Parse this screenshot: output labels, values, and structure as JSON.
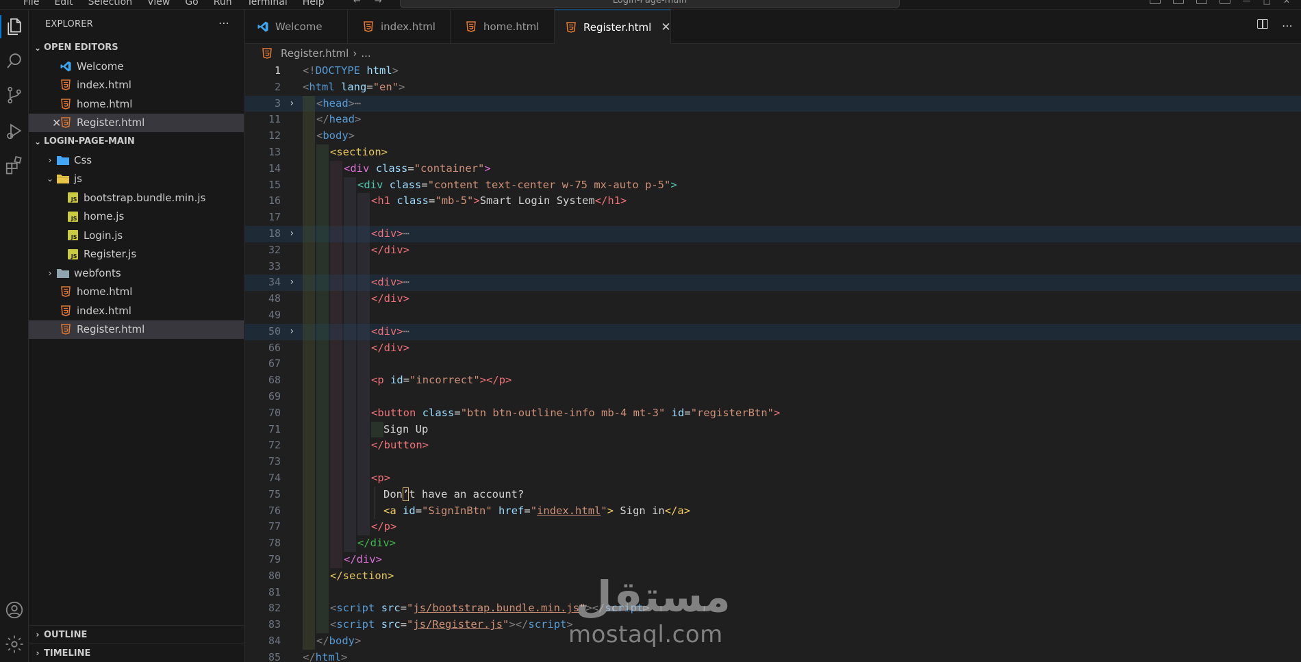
{
  "menu": [
    "File",
    "Edit",
    "Selection",
    "View",
    "Go",
    "Run",
    "Terminal",
    "Help"
  ],
  "command_center": "Login-Page-main",
  "sidebar": {
    "title": "EXPLORER",
    "open_editors_title": "OPEN EDITORS",
    "open_editors": [
      {
        "label": "Welcome",
        "icon": "vscode-icon"
      },
      {
        "label": "index.html",
        "icon": "html-file-icon"
      },
      {
        "label": "home.html",
        "icon": "html-file-icon"
      },
      {
        "label": "Register.html",
        "icon": "html-file-icon",
        "selected": true
      }
    ],
    "project_title": "LOGIN-PAGE-MAIN",
    "tree": [
      {
        "label": "Css",
        "type": "folder",
        "expanded": false
      },
      {
        "label": "js",
        "type": "folder",
        "expanded": true
      },
      {
        "label": "bootstrap.bundle.min.js",
        "type": "js"
      },
      {
        "label": "home.js",
        "type": "js"
      },
      {
        "label": "Login.js",
        "type": "js"
      },
      {
        "label": "Register.js",
        "type": "js"
      },
      {
        "label": "webfonts",
        "type": "folder",
        "expanded": false
      },
      {
        "label": "home.html",
        "type": "html"
      },
      {
        "label": "index.html",
        "type": "html"
      },
      {
        "label": "Register.html",
        "type": "html",
        "selected": true
      }
    ],
    "outline_title": "OUTLINE",
    "timeline_title": "TIMELINE"
  },
  "tabs": [
    {
      "label": "Welcome",
      "icon": "vscode-icon"
    },
    {
      "label": "index.html",
      "icon": "html-file-icon"
    },
    {
      "label": "home.html",
      "icon": "html-file-icon"
    },
    {
      "label": "Register.html",
      "icon": "html-file-icon",
      "active": true
    }
  ],
  "breadcrumb": {
    "file": "Register.html",
    "rest": "..."
  },
  "editor": {
    "current_line": "1",
    "lines": [
      {
        "n": "1"
      },
      {
        "n": "2"
      },
      {
        "n": "3"
      },
      {
        "n": "11"
      },
      {
        "n": "12"
      },
      {
        "n": "13"
      },
      {
        "n": "14"
      },
      {
        "n": "15"
      },
      {
        "n": "16"
      },
      {
        "n": "17"
      },
      {
        "n": "18"
      },
      {
        "n": "32"
      },
      {
        "n": "33"
      },
      {
        "n": "34"
      },
      {
        "n": "48"
      },
      {
        "n": "49"
      },
      {
        "n": "50"
      },
      {
        "n": "66"
      },
      {
        "n": "67"
      },
      {
        "n": "68"
      },
      {
        "n": "69"
      },
      {
        "n": "70"
      },
      {
        "n": "71"
      },
      {
        "n": "72"
      },
      {
        "n": "73"
      },
      {
        "n": "74"
      },
      {
        "n": "75"
      },
      {
        "n": "76"
      },
      {
        "n": "77"
      },
      {
        "n": "78"
      },
      {
        "n": "79"
      },
      {
        "n": "80"
      },
      {
        "n": "81"
      },
      {
        "n": "82"
      },
      {
        "n": "83"
      },
      {
        "n": "84"
      },
      {
        "n": "85"
      }
    ],
    "text": {
      "doctype": "DOCTYPE",
      "html": "html",
      "lang_attr": "lang",
      "lang_val": "\"en\"",
      "head": "head",
      "body": "body",
      "section": "section",
      "div": "div",
      "class_attr": "class",
      "container_val": "\"container\"",
      "content_val": "\"content text-center w-75 mx-auto p-5\"",
      "h1": "h1",
      "mb5_val": "\"mb-5\"",
      "h1_text": "Smart Login System",
      "p": "p",
      "id_attr": "id",
      "incorrect_val": "\"incorrect\"",
      "button": "button",
      "btn_class_val": "\"btn btn-outline-info mb-4 mt-3\"",
      "register_btn_val": "\"registerBtn\"",
      "sign_up": "Sign Up",
      "dont_pre": "Don",
      "dont_post": "t have an account?",
      "a": "a",
      "signin_id_val": "\"SignInBtn\"",
      "href_attr": "href",
      "href_val": "index.html",
      "sign_in": " Sign in",
      "script": "script",
      "src_attr": "src",
      "bootstrap_src": "js/bootstrap.bundle.min.js",
      "register_src": "js/Register.js",
      "ellipsis": "⋯"
    }
  },
  "watermark": {
    "arabic": "مستقل",
    "latin": "mostaql.com"
  }
}
